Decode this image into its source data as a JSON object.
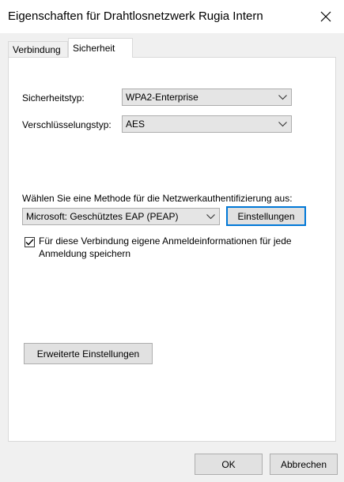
{
  "window": {
    "title": "Eigenschaften für Drahtlosnetzwerk Rugia Intern"
  },
  "tabs": [
    {
      "label": "Verbindung",
      "active": false
    },
    {
      "label": "Sicherheit",
      "active": true
    }
  ],
  "security": {
    "type_label": "Sicherheitstyp:",
    "type_value": "WPA2-Enterprise",
    "encryption_label": "Verschlüsselungstyp:",
    "encryption_value": "AES",
    "method_label": "Wählen Sie eine Methode für die Netzwerkauthentifizierung aus:",
    "method_value": "Microsoft: Geschütztes EAP (PEAP)",
    "settings_button": "Einstellungen",
    "remember_checkbox_label": "Für diese Verbindung eigene Anmeldeinformationen für jede Anmeldung speichern",
    "remember_checked": true,
    "advanced_button": "Erweiterte Einstellungen"
  },
  "footer": {
    "ok_label": "OK",
    "cancel_label": "Abbrechen"
  },
  "colors": {
    "focus_accent": "#0078d7"
  }
}
